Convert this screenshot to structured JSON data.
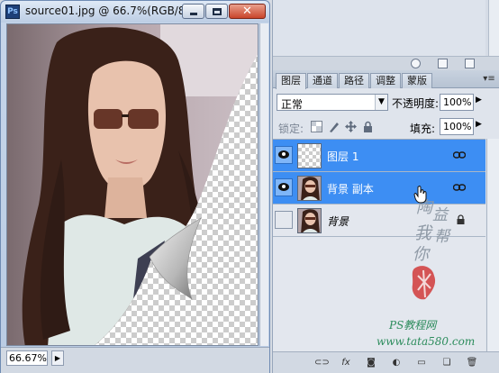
{
  "document_window": {
    "app_icon_text": "Ps",
    "title": "source01.jpg @ 66.7%(RGB/8...",
    "zoom_text": "66.67%"
  },
  "layers_panel": {
    "tabs": [
      {
        "label": "图层",
        "active": true
      },
      {
        "label": "通道",
        "active": false
      },
      {
        "label": "路径",
        "active": false
      },
      {
        "label": "调整",
        "active": false
      },
      {
        "label": "蒙版",
        "active": false
      }
    ],
    "blend_mode": "正常",
    "opacity_label": "不透明度:",
    "opacity_value": "100%",
    "lock_label": "锁定:",
    "fill_label": "填充:",
    "fill_value": "100%",
    "layers": [
      {
        "name": "图层 1",
        "visible": true,
        "selected": true,
        "thumbnail": "transparent"
      },
      {
        "name": "背景 副本",
        "visible": true,
        "selected": true,
        "thumbnail": "photo"
      },
      {
        "name": "背景",
        "visible": false,
        "selected": false,
        "thumbnail": "photo",
        "locked": true
      }
    ]
  },
  "watermark": {
    "chars": [
      "陶",
      "益",
      "我",
      "帮",
      "你"
    ],
    "seal_text": "印",
    "site_name": "PS教程网",
    "url": "www.tata580.com"
  },
  "colors": {
    "selection": "#3d8ef3",
    "title_bar": "#c7d6ea",
    "close_button": "#c9452b"
  }
}
